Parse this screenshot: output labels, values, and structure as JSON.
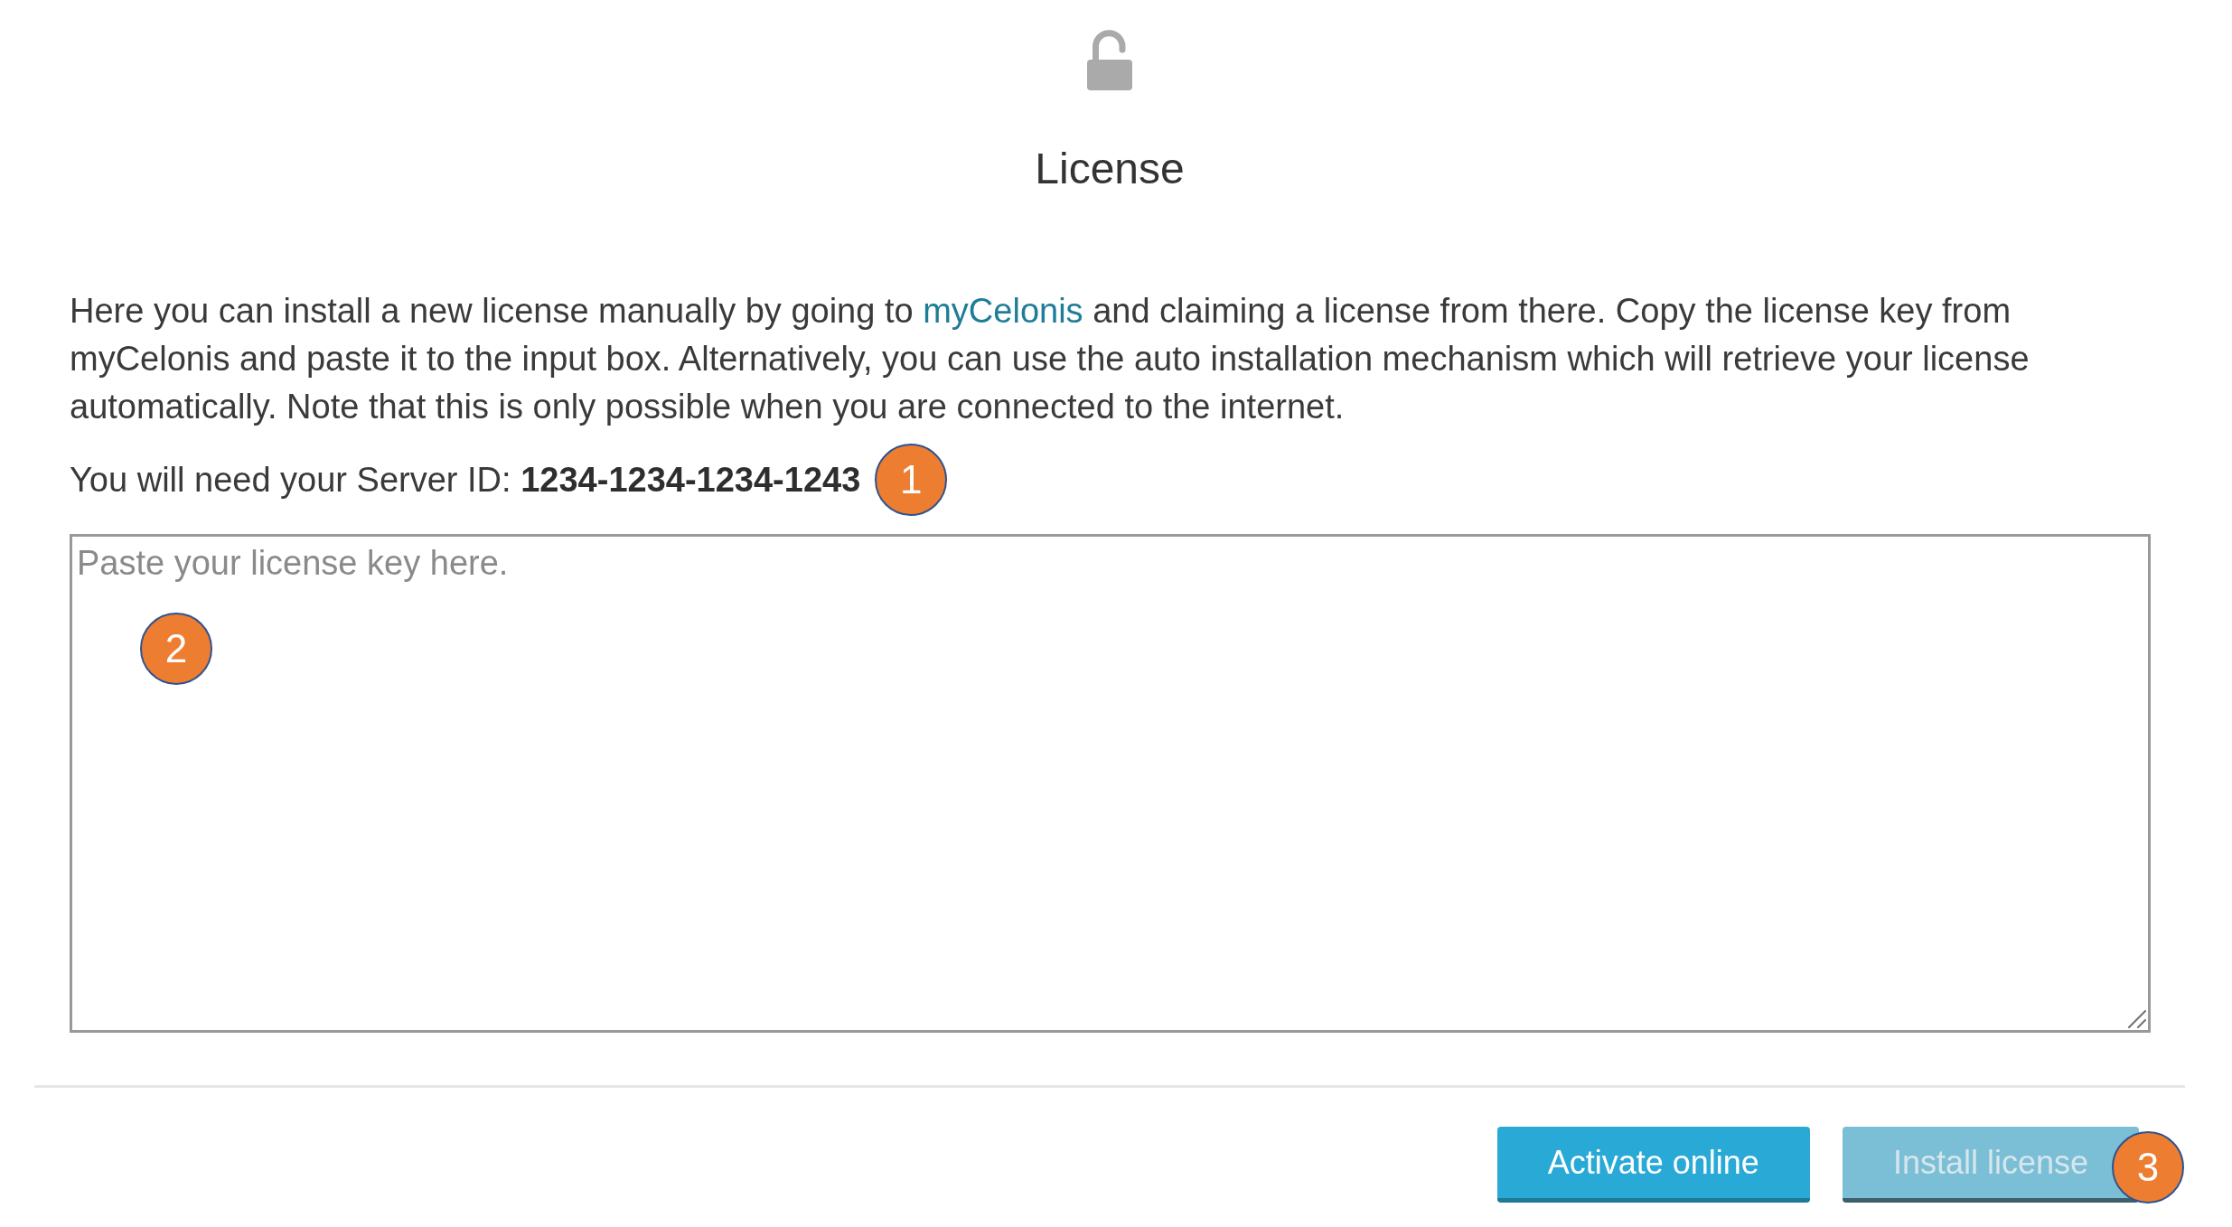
{
  "title": "License",
  "description": [
    {
      "kind": "text",
      "text": "Here you can install a new license manually by going to "
    },
    {
      "kind": "link",
      "text": "myCelonis"
    },
    {
      "kind": "text",
      "text": " and claiming a license from there. Copy the license key from myCelonis and paste it to the input box. Alternatively, you can use the auto installation mechanism which will retrieve your license automatically. Note that this is only possible when you are connected to the internet."
    }
  ],
  "server_id": {
    "text": "You will need your Server ID: **1234-1234-1234-1243**",
    "callout": "1"
  },
  "license_key_field": {
    "placeholder": "Paste your license key here.",
    "callout": "2"
  },
  "buttons": [
    {
      "label": "Activate online",
      "disabled": false
    },
    {
      "label": "Install license",
      "disabled": true,
      "callout": "3"
    }
  ]
}
